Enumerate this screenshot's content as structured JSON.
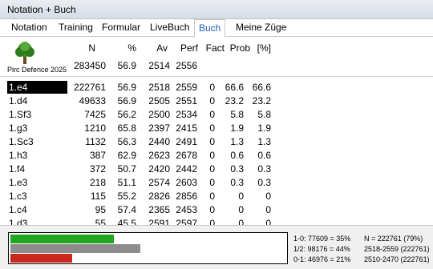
{
  "window": {
    "title": "Notation + Buch"
  },
  "tabs": [
    {
      "label": "Notation",
      "active": false
    },
    {
      "label": "Training",
      "active": false
    },
    {
      "label": "Formular",
      "active": false
    },
    {
      "label": "LiveBuch",
      "active": false
    },
    {
      "label": "Buch",
      "active": true
    },
    {
      "label": "Meine Züge",
      "active": false
    }
  ],
  "columns": {
    "n": "N",
    "pct": "%",
    "av": "Av",
    "perf": "Perf",
    "fact": "Fact",
    "prob": "Prob",
    "prob_pct": "[%]"
  },
  "summary": {
    "opening": "Pirc Defence 2025",
    "n": "283450",
    "pct": "56.9",
    "av": "2514",
    "perf": "2556"
  },
  "moves": [
    {
      "move": "1.e4",
      "n": "222761",
      "pct": "56.9",
      "av": "2518",
      "perf": "2559",
      "fact": "0",
      "prob": "66.6",
      "prob_pct": "66.6",
      "selected": true
    },
    {
      "move": "1.d4",
      "n": "49633",
      "pct": "56.9",
      "av": "2505",
      "perf": "2551",
      "fact": "0",
      "prob": "23.2",
      "prob_pct": "23.2"
    },
    {
      "move": "1.Sf3",
      "n": "7425",
      "pct": "56.2",
      "av": "2500",
      "perf": "2534",
      "fact": "0",
      "prob": "5.8",
      "prob_pct": "5.8"
    },
    {
      "move": "1.g3",
      "n": "1210",
      "pct": "65.8",
      "av": "2397",
      "perf": "2415",
      "fact": "0",
      "prob": "1.9",
      "prob_pct": "1.9"
    },
    {
      "move": "1.Sc3",
      "n": "1132",
      "pct": "56.3",
      "av": "2440",
      "perf": "2491",
      "fact": "0",
      "prob": "1.3",
      "prob_pct": "1.3"
    },
    {
      "move": "1.h3",
      "n": "387",
      "pct": "62.9",
      "av": "2623",
      "perf": "2678",
      "fact": "0",
      "prob": "0.6",
      "prob_pct": "0.6"
    },
    {
      "move": "1.f4",
      "n": "372",
      "pct": "50.7",
      "av": "2420",
      "perf": "2442",
      "fact": "0",
      "prob": "0.3",
      "prob_pct": "0.3"
    },
    {
      "move": "1.e3",
      "n": "218",
      "pct": "51.1",
      "av": "2574",
      "perf": "2603",
      "fact": "0",
      "prob": "0.3",
      "prob_pct": "0.3"
    },
    {
      "move": "1.c3",
      "n": "115",
      "pct": "55.2",
      "av": "2826",
      "perf": "2856",
      "fact": "0",
      "prob": "0",
      "prob_pct": "0"
    },
    {
      "move": "1.c4",
      "n": "95",
      "pct": "57.4",
      "av": "2365",
      "perf": "2453",
      "fact": "0",
      "prob": "0",
      "prob_pct": "0"
    },
    {
      "move": "1.d3",
      "n": "55",
      "pct": "45.5",
      "av": "2591",
      "perf": "2597",
      "fact": "0",
      "prob": "0",
      "prob_pct": "0"
    }
  ],
  "results": {
    "white_line": "1-0: 77609 = 35%",
    "draw_line": "1/2: 98176 = 44%",
    "black_line": "0-1: 46976 = 21%",
    "total_line": "N = 222761 (79%)",
    "range1": "2518-2559 (222761)",
    "range2": "2510-2470 (222761)",
    "white_fraction": 0.35,
    "draw_fraction": 0.44,
    "black_fraction": 0.21,
    "colors": {
      "white": "#22a522",
      "draw": "#8c8c8c",
      "black": "#c8281e"
    }
  }
}
